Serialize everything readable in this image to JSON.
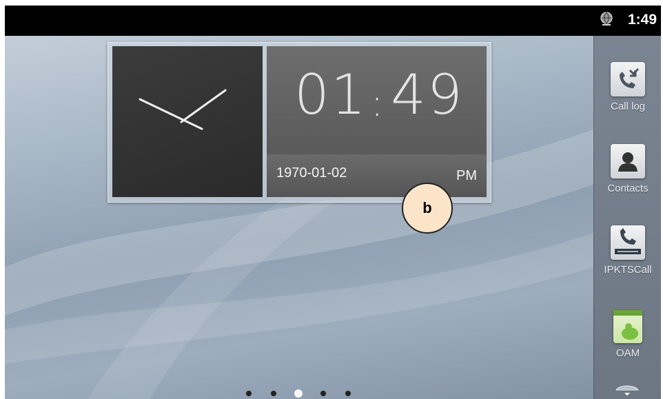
{
  "status_bar": {
    "time": "1:49"
  },
  "clock_widget": {
    "hours": "01",
    "separator": ":",
    "minutes": "49",
    "date": "1970-01-02",
    "ampm": "PM"
  },
  "annotation": {
    "label": "b"
  },
  "dock": {
    "items": [
      {
        "label": "Call log",
        "icon": "call-log-icon"
      },
      {
        "label": "Contacts",
        "icon": "contacts-icon"
      },
      {
        "label": "IPKTSCall",
        "icon": "ipecs-phone-icon"
      },
      {
        "label": "OAM",
        "icon": "android-app-icon"
      }
    ]
  },
  "home_pages": {
    "count": 5,
    "active_index": 2
  },
  "colors": {
    "status_bar": "#000000",
    "badge_fill": "#fbe4c8",
    "dock": "#747e8b"
  }
}
